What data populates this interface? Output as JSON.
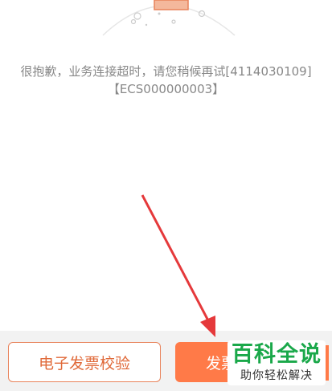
{
  "error": {
    "line1": "很抱歉，业务连接超时，请您稍候再试[4114030109]",
    "line2": "【ECS000000003】"
  },
  "buttons": {
    "verify_label": "电子发票校验",
    "primary_label": "发票"
  },
  "watermark": {
    "title": "百科全说",
    "subtitle": "助你轻松解决"
  },
  "colors": {
    "accent": "#ff7a48",
    "arrow": "#e5393b",
    "watermark_green": "#1aa84a"
  }
}
